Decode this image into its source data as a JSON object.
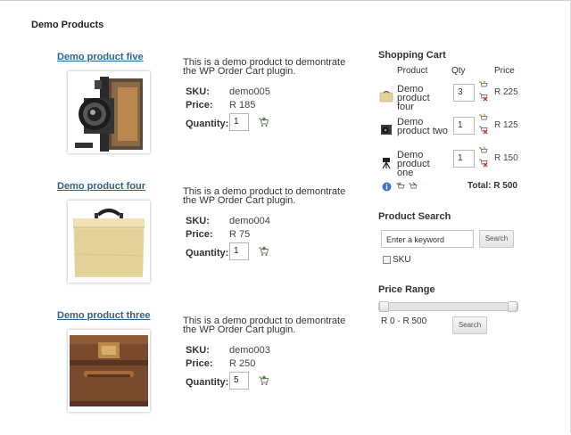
{
  "page": {
    "title": "Demo Products"
  },
  "products": [
    {
      "name": "Demo product five",
      "description": "This is a demo product to demontrate the WP Order Cart plugin.",
      "sku_label": "SKU:",
      "sku": "demo005",
      "price_label": "Price:",
      "price": "R 185",
      "qty_label": "Quantity:",
      "qty": "1",
      "image_icon": "folding-camera"
    },
    {
      "name": "Demo product four",
      "description": "This is a demo product to demontrate the WP Order Cart plugin.",
      "sku_label": "SKU:",
      "sku": "demo004",
      "price_label": "Price:",
      "price": "R 75",
      "qty_label": "Quantity:",
      "qty": "1",
      "image_icon": "wooden-case"
    },
    {
      "name": "Demo product three",
      "description": "This is a demo product to demontrate the WP Order Cart plugin.",
      "sku_label": "SKU:",
      "sku": "demo003",
      "price_label": "Price:",
      "price": "R 250",
      "qty_label": "Quantity:",
      "qty": "5",
      "image_icon": "leather-suitcase"
    }
  ],
  "cart": {
    "title": "Shopping Cart",
    "headers": {
      "product": "Product",
      "qty": "Qty",
      "price": "Price"
    },
    "items": [
      {
        "name": "Demo product four",
        "qty": "3",
        "price": "R 225",
        "thumb_icon": "box-thumb"
      },
      {
        "name": "Demo product two",
        "qty": "1",
        "price": "R 125",
        "thumb_icon": "camera-thumb"
      },
      {
        "name": "Demo product one",
        "qty": "1",
        "price": "R 150",
        "thumb_icon": "tripod-thumb"
      }
    ],
    "total": "Total: R 500"
  },
  "search": {
    "title": "Product Search",
    "placeholder": "Enter a keyword",
    "button": "Search",
    "sku_label": "SKU",
    "sku_checked": false
  },
  "range": {
    "title": "Price Range",
    "text": "R 0 - R 500",
    "min": 0,
    "max": 500,
    "low": 0,
    "high": 500,
    "button": "Search"
  },
  "colors": {
    "link": "#2a6496",
    "text": "#333333",
    "cart_icon_green": "#4a9a2a"
  }
}
